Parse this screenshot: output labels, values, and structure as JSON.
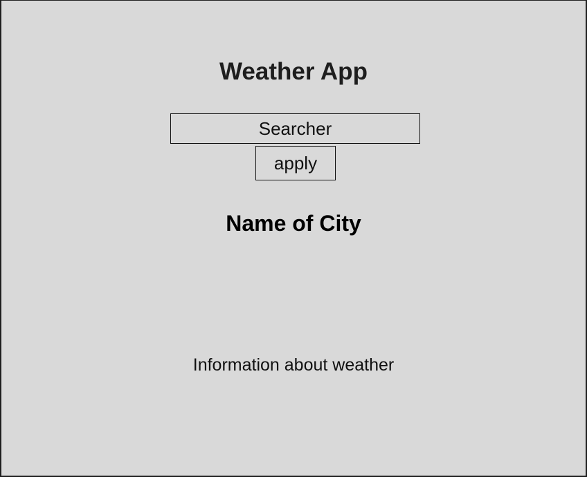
{
  "app": {
    "title": "Weather App"
  },
  "search": {
    "placeholder": "Searcher",
    "apply_label": "apply"
  },
  "result": {
    "city_name": "Name of City",
    "weather_info": "Information about weather"
  },
  "colors": {
    "background": "#d9d9d9",
    "text": "#111111",
    "border": "#111111"
  }
}
